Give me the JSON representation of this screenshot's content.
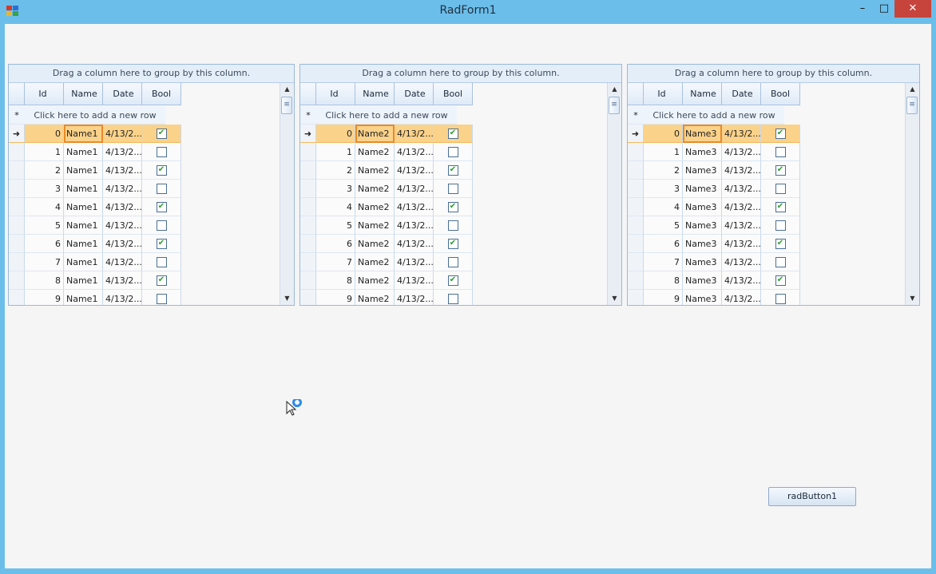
{
  "window": {
    "title": "RadForm1",
    "minimize": "–",
    "maximize": "□",
    "close": "✕"
  },
  "grid": {
    "group_hint": "Drag a column here to group by this column.",
    "columns": [
      "Id",
      "Name",
      "Date",
      "Bool"
    ],
    "new_row_text": "Click here to add a new row",
    "new_row_marker": "*",
    "current_marker": "➜",
    "date_text": "4/13/2...",
    "bools": [
      true,
      false,
      true,
      false,
      true,
      false,
      true,
      false,
      true,
      false
    ]
  },
  "grids": [
    {
      "name_text": "Name1"
    },
    {
      "name_text": "Name2"
    },
    {
      "name_text": "Name3"
    }
  ],
  "button": {
    "label": "radButton1"
  },
  "colors": {
    "title_bar": "#6cbeea",
    "selection": "#fbd28a",
    "close": "#c7443c"
  }
}
